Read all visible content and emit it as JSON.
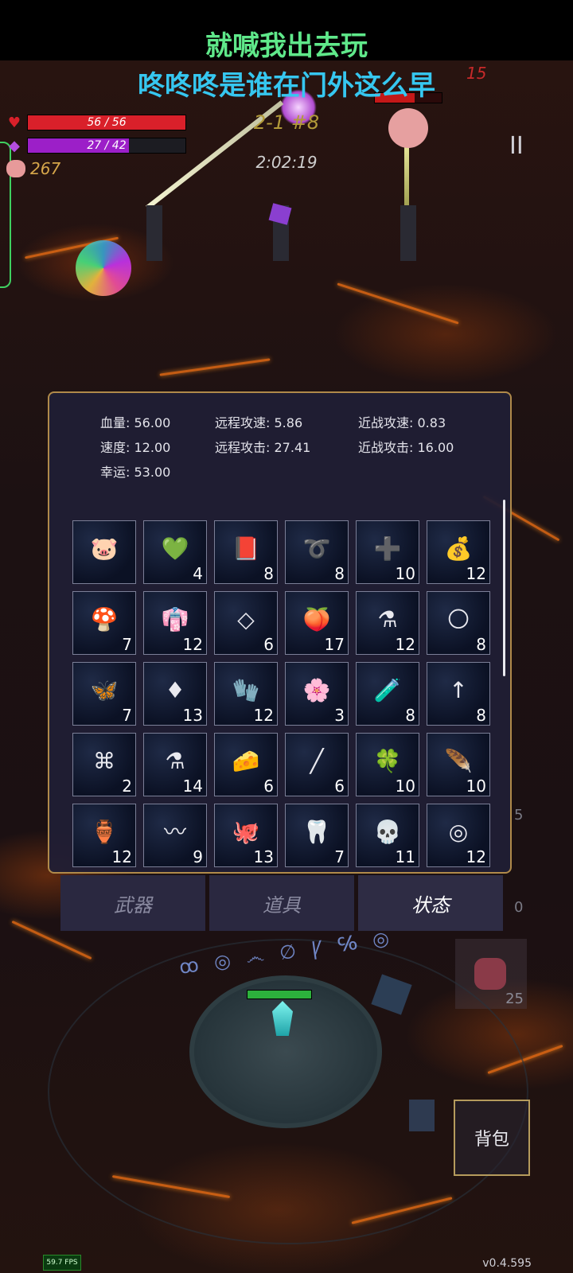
{
  "subtitles": {
    "line1": "就喊我出去玩",
    "line2": "咚咚咚是谁在门外这么早"
  },
  "player": {
    "hp": {
      "text": "56 / 56",
      "current": 56,
      "max": 56,
      "color": "#d9202a"
    },
    "mp": {
      "text": "27 / 42",
      "current": 27,
      "max": 42,
      "color": "#9c1fc8"
    },
    "coins": "267"
  },
  "stage": {
    "label": "2-1 #8",
    "timer": "2:02:19"
  },
  "pause_symbol": "II",
  "enemy_damage": "15",
  "stats": [
    {
      "label": "血量:",
      "value": "56.00"
    },
    {
      "label": "远程攻速:",
      "value": "5.86"
    },
    {
      "label": "近战攻速:",
      "value": "0.83"
    },
    {
      "label": "速度:",
      "value": "12.00"
    },
    {
      "label": "远程攻击:",
      "value": "27.41"
    },
    {
      "label": "近战攻击:",
      "value": "16.00"
    },
    {
      "label": "幸运:",
      "value": "53.00"
    }
  ],
  "items": [
    {
      "icon": "piggy-bank-icon",
      "glyph": "🐷",
      "count": ""
    },
    {
      "icon": "green-crystal-icon",
      "glyph": "💚",
      "count": "4"
    },
    {
      "icon": "spellbook-icon",
      "glyph": "📕",
      "count": "8"
    },
    {
      "icon": "thorn-crown-icon",
      "glyph": "➰",
      "count": "8"
    },
    {
      "icon": "medkit-icon",
      "glyph": "➕",
      "count": "10"
    },
    {
      "icon": "money-sack-icon",
      "glyph": "💰",
      "count": "12"
    },
    {
      "icon": "mushroom-icon",
      "glyph": "🍄",
      "count": "7"
    },
    {
      "icon": "cloak-icon",
      "glyph": "👘",
      "count": "12"
    },
    {
      "icon": "diamond-sign-icon",
      "glyph": "◇",
      "count": "6"
    },
    {
      "icon": "peach-icon",
      "glyph": "🍑",
      "count": "17"
    },
    {
      "icon": "blue-potion-icon",
      "glyph": "⚗",
      "count": "12"
    },
    {
      "icon": "gold-coin-icon",
      "glyph": "🌕",
      "count": "8"
    },
    {
      "icon": "dragonfly-icon",
      "glyph": "🦋",
      "count": "7"
    },
    {
      "icon": "red-crystal-icon",
      "glyph": "♦",
      "count": "13"
    },
    {
      "icon": "gloves-icon",
      "glyph": "🧤",
      "count": "12"
    },
    {
      "icon": "flower-garland-icon",
      "glyph": "🌸",
      "count": "3"
    },
    {
      "icon": "bottle-icon",
      "glyph": "🧪",
      "count": "8"
    },
    {
      "icon": "arrow-up-icon",
      "glyph": "↑",
      "count": "8"
    },
    {
      "icon": "rune-card-icon",
      "glyph": "⌘",
      "count": "2"
    },
    {
      "icon": "green-potion-icon",
      "glyph": "⚗",
      "count": "14"
    },
    {
      "icon": "cheese-block-icon",
      "glyph": "🧀",
      "count": "6"
    },
    {
      "icon": "purple-vial-icon",
      "glyph": "╱",
      "count": "6"
    },
    {
      "icon": "clover-icon",
      "glyph": "🍀",
      "count": "10"
    },
    {
      "icon": "feather-icon",
      "glyph": "🪶",
      "count": "10"
    },
    {
      "icon": "small-flask-icon",
      "glyph": "🏺",
      "count": "12"
    },
    {
      "icon": "worm-icon",
      "glyph": "〰",
      "count": "9"
    },
    {
      "icon": "octopus-icon",
      "glyph": "🐙",
      "count": "13"
    },
    {
      "icon": "fang-icon",
      "glyph": "🦷",
      "count": "7"
    },
    {
      "icon": "feathered-skull-icon",
      "glyph": "💀",
      "count": "11"
    },
    {
      "icon": "rings-icon",
      "glyph": "◎",
      "count": "12"
    }
  ],
  "tabs": [
    {
      "label": "武器",
      "active": false
    },
    {
      "label": "道具",
      "active": false
    },
    {
      "label": "状态",
      "active": true
    }
  ],
  "bag_label": "背包",
  "fps": "59.7 FPS",
  "version": "v0.4.595",
  "side_values": [
    "5",
    "0",
    "25"
  ],
  "rune_circle": "ꝏ ◎ ෴ ∅ Ꝩ ℅ ◎"
}
